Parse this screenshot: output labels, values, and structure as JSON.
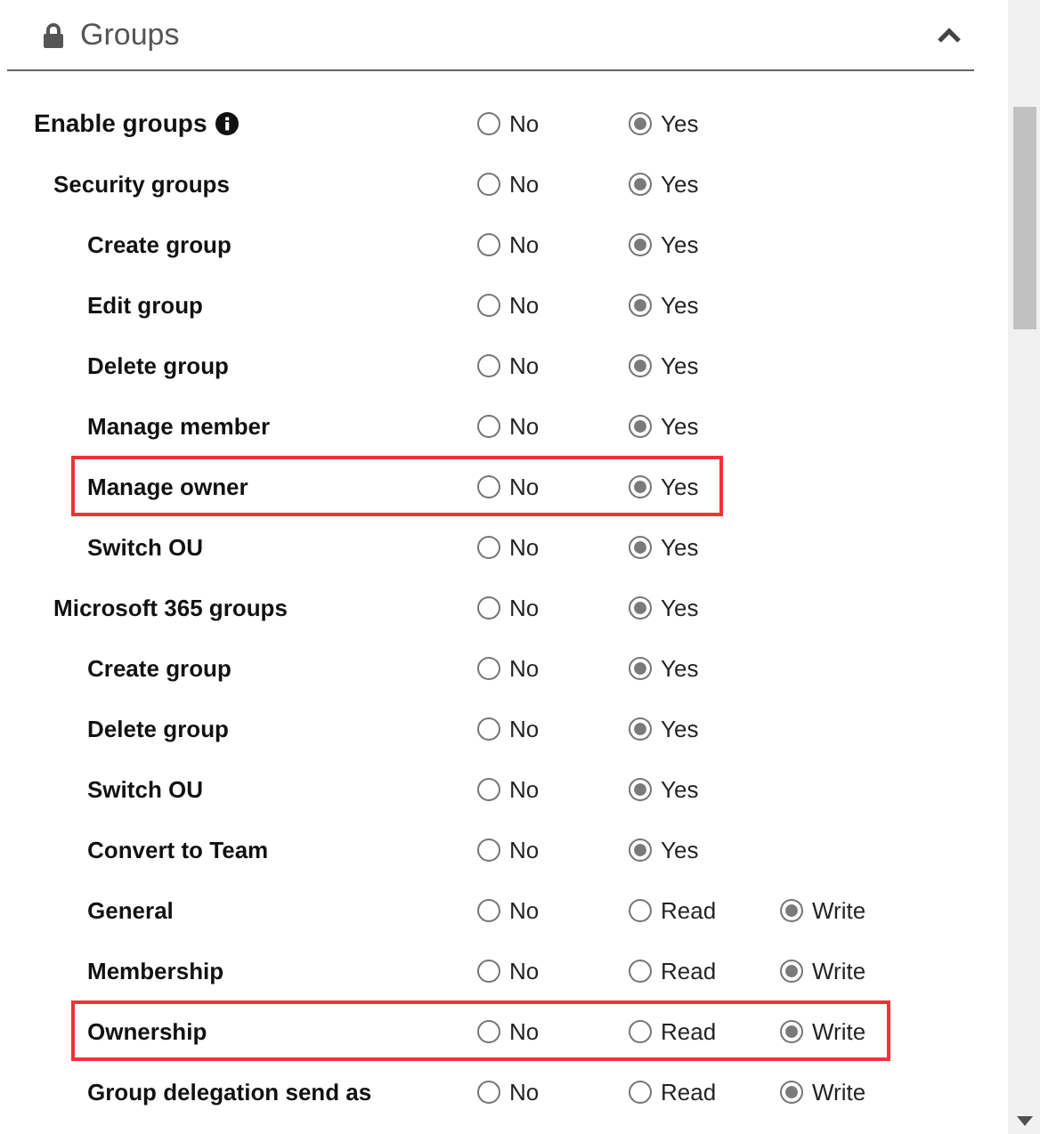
{
  "section": {
    "title": "Groups",
    "expanded": true
  },
  "rows": [
    {
      "label": "Enable groups",
      "info_icon": true,
      "highlighted": false,
      "options": [
        {
          "label": "No",
          "selected": false
        },
        {
          "label": "Yes",
          "selected": true
        }
      ],
      "children": [
        {
          "label": "Security groups",
          "highlighted": false,
          "options": [
            {
              "label": "No",
              "selected": false
            },
            {
              "label": "Yes",
              "selected": true
            }
          ],
          "children": [
            {
              "label": "Create group",
              "highlighted": false,
              "options": [
                {
                  "label": "No",
                  "selected": false
                },
                {
                  "label": "Yes",
                  "selected": true
                }
              ]
            },
            {
              "label": "Edit group",
              "highlighted": false,
              "options": [
                {
                  "label": "No",
                  "selected": false
                },
                {
                  "label": "Yes",
                  "selected": true
                }
              ]
            },
            {
              "label": "Delete group",
              "highlighted": false,
              "options": [
                {
                  "label": "No",
                  "selected": false
                },
                {
                  "label": "Yes",
                  "selected": true
                }
              ]
            },
            {
              "label": "Manage member",
              "highlighted": false,
              "options": [
                {
                  "label": "No",
                  "selected": false
                },
                {
                  "label": "Yes",
                  "selected": true
                }
              ]
            },
            {
              "label": "Manage owner",
              "highlighted": true,
              "options": [
                {
                  "label": "No",
                  "selected": false
                },
                {
                  "label": "Yes",
                  "selected": true
                }
              ]
            },
            {
              "label": "Switch OU",
              "highlighted": false,
              "options": [
                {
                  "label": "No",
                  "selected": false
                },
                {
                  "label": "Yes",
                  "selected": true
                }
              ]
            }
          ]
        },
        {
          "label": "Microsoft 365 groups",
          "highlighted": false,
          "options": [
            {
              "label": "No",
              "selected": false
            },
            {
              "label": "Yes",
              "selected": true
            }
          ],
          "children": [
            {
              "label": "Create group",
              "highlighted": false,
              "options": [
                {
                  "label": "No",
                  "selected": false
                },
                {
                  "label": "Yes",
                  "selected": true
                }
              ]
            },
            {
              "label": "Delete group",
              "highlighted": false,
              "options": [
                {
                  "label": "No",
                  "selected": false
                },
                {
                  "label": "Yes",
                  "selected": true
                }
              ]
            },
            {
              "label": "Switch OU",
              "highlighted": false,
              "options": [
                {
                  "label": "No",
                  "selected": false
                },
                {
                  "label": "Yes",
                  "selected": true
                }
              ]
            },
            {
              "label": "Convert to Team",
              "highlighted": false,
              "options": [
                {
                  "label": "No",
                  "selected": false
                },
                {
                  "label": "Yes",
                  "selected": true
                }
              ]
            },
            {
              "label": "General",
              "highlighted": false,
              "options": [
                {
                  "label": "No",
                  "selected": false
                },
                {
                  "label": "Read",
                  "selected": false
                },
                {
                  "label": "Write",
                  "selected": true
                }
              ]
            },
            {
              "label": "Membership",
              "highlighted": false,
              "options": [
                {
                  "label": "No",
                  "selected": false
                },
                {
                  "label": "Read",
                  "selected": false
                },
                {
                  "label": "Write",
                  "selected": true
                }
              ]
            },
            {
              "label": "Ownership",
              "highlighted": true,
              "options": [
                {
                  "label": "No",
                  "selected": false
                },
                {
                  "label": "Read",
                  "selected": false
                },
                {
                  "label": "Write",
                  "selected": true
                }
              ]
            },
            {
              "label": "Group delegation send as",
              "highlighted": false,
              "options": [
                {
                  "label": "No",
                  "selected": false
                },
                {
                  "label": "Read",
                  "selected": false
                },
                {
                  "label": "Write",
                  "selected": true
                }
              ]
            }
          ]
        }
      ]
    }
  ]
}
